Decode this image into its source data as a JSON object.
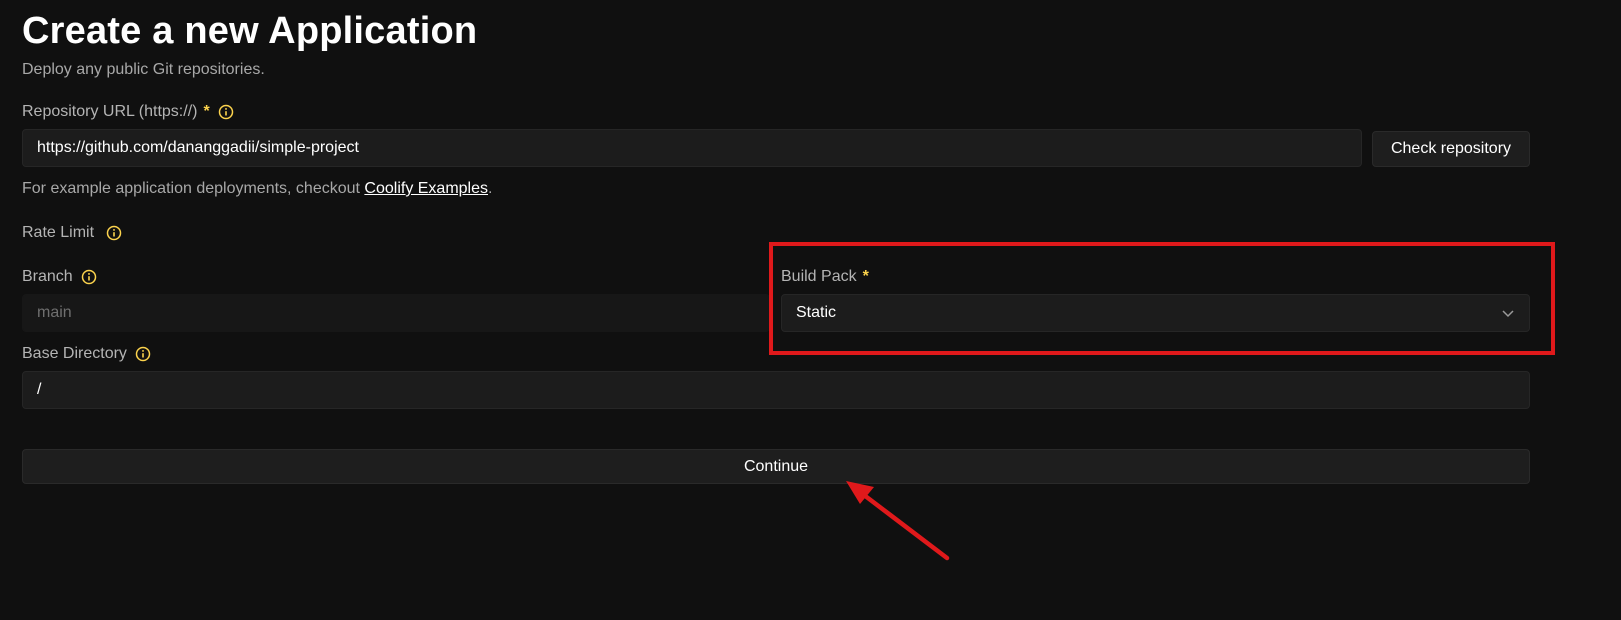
{
  "header": {
    "title": "Create a new Application",
    "subtitle": "Deploy any public Git repositories."
  },
  "repository": {
    "label": "Repository URL (https://)",
    "required_mark": "*",
    "value": "https://github.com/dananggadii/simple-project",
    "check_button": "Check repository"
  },
  "helper": {
    "prefix": "For example application deployments, checkout ",
    "link": "Coolify Examples",
    "suffix": "."
  },
  "rate_limit": {
    "label": "Rate Limit"
  },
  "branch": {
    "label": "Branch",
    "value": "main"
  },
  "build_pack": {
    "label": "Build Pack",
    "required_mark": "*",
    "selected": "Static"
  },
  "base_directory": {
    "label": "Base Directory",
    "value": "/"
  },
  "continue_button": "Continue",
  "colors": {
    "background": "#101010",
    "required": "#fcd34d",
    "info_icon": "#fcd34d",
    "annotation": "#e0191b"
  },
  "icons": {
    "info": "info-circle-icon",
    "chevron": "chevron-down-icon"
  }
}
